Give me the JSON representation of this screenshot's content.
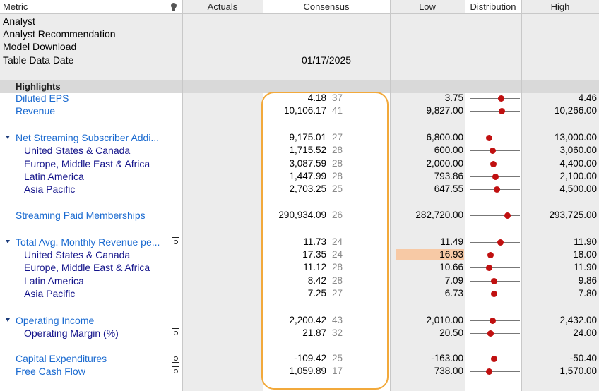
{
  "headers": {
    "metric": "Metric",
    "actuals": "Actuals",
    "consensus": "Consensus",
    "low": "Low",
    "distribution": "Distribution",
    "high": "High",
    "metric_icon": "lightbulb-icon"
  },
  "info_rows": [
    {
      "label": "Analyst",
      "value": ""
    },
    {
      "label": "Analyst Recommendation",
      "value": ""
    },
    {
      "label": "Model Download",
      "value": ""
    },
    {
      "label": "Table Data Date",
      "value": "01/17/2025"
    }
  ],
  "section": {
    "label": "Highlights"
  },
  "colors": {
    "link_blue": "#1a6ad0",
    "sub_navy": "#13138a",
    "dot_red": "#c01010",
    "highlight_orange": "#f2a93b",
    "low_highlight": "#f7c9a5"
  },
  "rows": [
    {
      "name": "Diluted EPS",
      "level": 0,
      "consensus": "4.18",
      "count": "37",
      "low": "3.75",
      "high": "4.46",
      "dist": 0.62
    },
    {
      "name": "Revenue",
      "level": 0,
      "consensus": "10,106.17",
      "count": "41",
      "low": "9,827.00",
      "high": "10,266.00",
      "dist": 0.64
    },
    {
      "name": "Net Streaming Subscriber Addi...",
      "level": 0,
      "collapse": true,
      "consensus": "9,175.01",
      "count": "27",
      "low": "6,800.00",
      "high": "13,000.00",
      "dist": 0.38
    },
    {
      "name": "United States & Canada",
      "level": 1,
      "consensus": "1,715.52",
      "count": "28",
      "low": "600.00",
      "high": "3,060.00",
      "dist": 0.45
    },
    {
      "name": "Europe, Middle East & Africa",
      "level": 1,
      "consensus": "3,087.59",
      "count": "28",
      "low": "2,000.00",
      "high": "4,400.00",
      "dist": 0.46
    },
    {
      "name": "Latin America",
      "level": 1,
      "consensus": "1,447.99",
      "count": "28",
      "low": "793.86",
      "high": "2,100.00",
      "dist": 0.5
    },
    {
      "name": "Asia Pacific",
      "level": 1,
      "consensus": "2,703.25",
      "count": "25",
      "low": "647.55",
      "high": "4,500.00",
      "dist": 0.53
    },
    {
      "name": "Streaming Paid Memberships",
      "level": 0,
      "consensus": "290,934.09",
      "count": "26",
      "low": "282,720.00",
      "high": "293,725.00",
      "dist": 0.75
    },
    {
      "name": "Total Avg. Monthly Revenue pe...",
      "level": 0,
      "collapse": true,
      "doc": true,
      "consensus": "11.73",
      "count": "24",
      "low": "11.49",
      "high": "11.90",
      "dist": 0.6
    },
    {
      "name": "United States & Canada",
      "level": 1,
      "consensus": "17.35",
      "count": "24",
      "low": "16.93",
      "high": "18.00",
      "low_highlight": true,
      "dist": 0.4
    },
    {
      "name": "Europe, Middle East & Africa",
      "level": 1,
      "consensus": "11.12",
      "count": "28",
      "low": "10.66",
      "high": "11.90",
      "dist": 0.38
    },
    {
      "name": "Latin America",
      "level": 1,
      "consensus": "8.42",
      "count": "28",
      "low": "7.09",
      "high": "9.86",
      "dist": 0.48
    },
    {
      "name": "Asia Pacific",
      "level": 1,
      "consensus": "7.25",
      "count": "27",
      "low": "6.73",
      "high": "7.80",
      "dist": 0.48
    },
    {
      "name": "Operating Income",
      "level": 0,
      "collapse": true,
      "consensus": "2,200.42",
      "count": "43",
      "low": "2,010.00",
      "high": "2,432.00",
      "dist": 0.45
    },
    {
      "name": "Operating Margin (%)",
      "level": 1,
      "doc": true,
      "consensus": "21.87",
      "count": "32",
      "low": "20.50",
      "high": "24.00",
      "dist": 0.4
    },
    {
      "name": "Capital Expenditures",
      "level": 0,
      "doc": true,
      "consensus": "-109.42",
      "count": "25",
      "low": "-163.00",
      "high": "-50.40",
      "dist": 0.48
    },
    {
      "name": "Free Cash Flow",
      "level": 0,
      "doc": true,
      "consensus": "1,059.89",
      "count": "17",
      "low": "738.00",
      "high": "1,570.00",
      "dist": 0.38
    }
  ]
}
